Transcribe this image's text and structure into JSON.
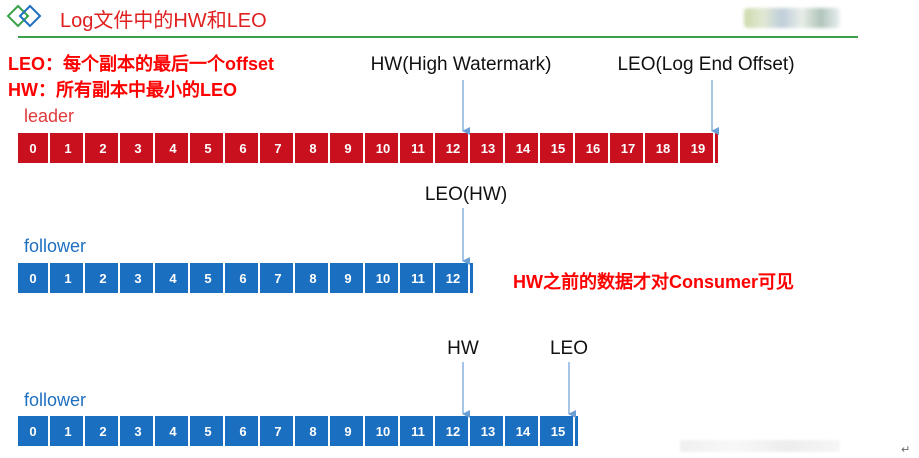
{
  "slide": {
    "title": "Log文件中的HW和LEO",
    "return_mark": "↵"
  },
  "definitions": {
    "leo": "LEO：每个副本的最后一个offset",
    "hw": "HW：所有副本中最小的LEO"
  },
  "rows": [
    {
      "label": "leader",
      "cells": [
        "0",
        "1",
        "2",
        "3",
        "4",
        "5",
        "6",
        "7",
        "8",
        "9",
        "10",
        "11",
        "12",
        "13",
        "14",
        "15",
        "16",
        "17",
        "18",
        "19"
      ]
    },
    {
      "label": "follower",
      "cells": [
        "0",
        "1",
        "2",
        "3",
        "4",
        "5",
        "6",
        "7",
        "8",
        "9",
        "10",
        "11",
        "12"
      ]
    },
    {
      "label": "follower",
      "cells": [
        "0",
        "1",
        "2",
        "3",
        "4",
        "5",
        "6",
        "7",
        "8",
        "9",
        "10",
        "11",
        "12",
        "13",
        "14",
        "15"
      ]
    }
  ],
  "markers": {
    "leader_hw": {
      "label": "HW(High Watermark)",
      "offset": 12
    },
    "leader_leo": {
      "label": "LEO(Log End Offset)",
      "offset": 19
    },
    "follower1_leo_hw": {
      "label": "LEO(HW)",
      "offset": 12
    },
    "follower2_hw": {
      "label": "HW",
      "offset": 12
    },
    "follower2_leo": {
      "label": "LEO",
      "offset": 15
    }
  },
  "note": "HW之前的数据才对Consumer可见",
  "colors": {
    "title": "#e02020",
    "leader_row": "#c8101e",
    "follower_row": "#1a6fc0",
    "arrow": "#6c9ed6",
    "emphasis": "#ff0000",
    "header_rule": "#3aa04a"
  }
}
